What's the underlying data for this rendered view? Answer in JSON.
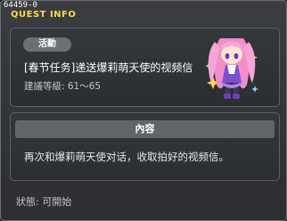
{
  "window": {
    "id": "64459-0",
    "title": "QUEST INFO"
  },
  "quest": {
    "badge": "活動",
    "name": "[春节任务]递送爆莉萌天使的视频信",
    "recommended_level": "建議等級: 61〜65",
    "npc_portrait": "angelic-buster-portrait"
  },
  "content": {
    "header": "內容",
    "text": "再次和爆莉萌天使对话，收取拍好的视频信。"
  },
  "status": {
    "text": "狀態: 可開始"
  }
}
